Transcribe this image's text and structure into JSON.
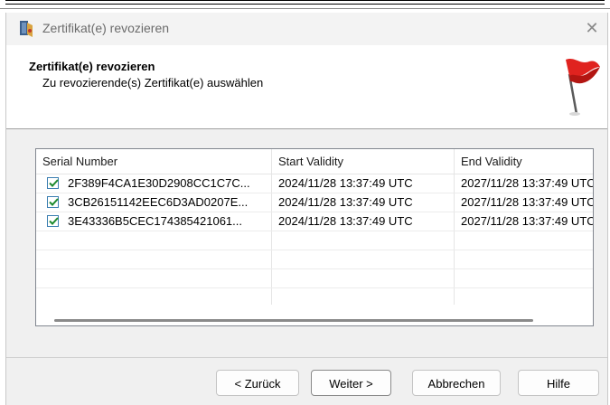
{
  "window": {
    "title": "Zertifikat(e) revozieren",
    "close_glyph": "✕"
  },
  "header": {
    "title": "Zertifikat(e) revozieren",
    "subtitle": "Zu revozierende(s) Zertifikat(e) auswählen",
    "icon": "red-flag-icon"
  },
  "list": {
    "columns": [
      "Serial Number",
      "Start Validity",
      "End Validity"
    ],
    "rows": [
      {
        "checked": true,
        "serial": "2F389F4CA1E30D2908CC1C7C...",
        "start": "2024/11/28 13:37:49 UTC",
        "end": "2027/11/28 13:37:49 UTC"
      },
      {
        "checked": true,
        "serial": "3CB26151142EEC6D3AD0207E...",
        "start": "2024/11/28 13:37:49 UTC",
        "end": "2027/11/28 13:37:49 UTC"
      },
      {
        "checked": true,
        "serial": "3E43336B5CEC174385421061...",
        "start": "2024/11/28 13:37:49 UTC",
        "end": "2027/11/28 13:37:49 UTC"
      }
    ]
  },
  "buttons": {
    "back": "< Zurück",
    "next": "Weiter >",
    "cancel": "Abbrechen",
    "help": "Hilfe"
  },
  "colors": {
    "check": "#1e8a2e",
    "flag": "#e0231f",
    "checkbox_border": "#3c7fb1"
  }
}
